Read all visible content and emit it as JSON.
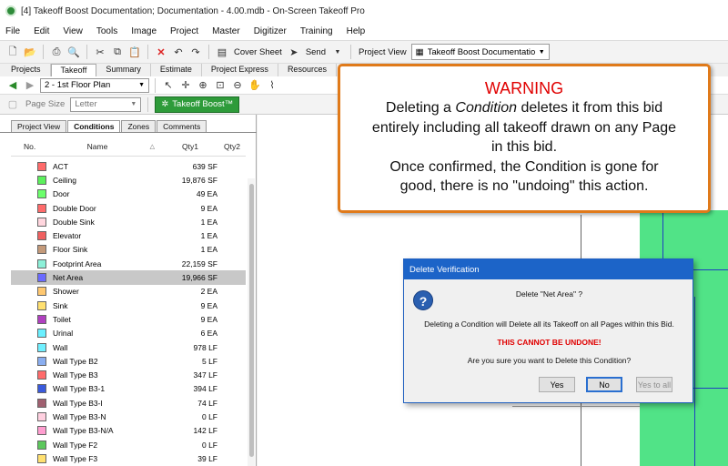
{
  "window": {
    "title": "[4] Takeoff Boost Documentation; Documentation - 4.00.mdb - On-Screen Takeoff Pro"
  },
  "menu": [
    "File",
    "Edit",
    "View",
    "Tools",
    "Image",
    "Project",
    "Master",
    "Digitizer",
    "Training",
    "Help"
  ],
  "toolbar": {
    "cover_sheet": "Cover Sheet",
    "send": "Send",
    "project_view_label": "Project View",
    "project_combo": "Takeoff Boost Documentatio"
  },
  "main_tabs": [
    "Projects",
    "Takeoff",
    "Summary",
    "Estimate",
    "Project Express",
    "Resources"
  ],
  "active_main_tab": "Takeoff",
  "page_combo": "2 - 1st Floor Plan",
  "page_size_label": "Page Size",
  "page_size_value": "Letter",
  "boost_button": "Takeoff Boost™",
  "panel_tabs": [
    "Project View",
    "Conditions",
    "Zones",
    "Comments"
  ],
  "active_panel_tab": "Conditions",
  "grid_headers": {
    "no": "No.",
    "name": "Name",
    "qty1": "Qty1",
    "qty2": "Qty2"
  },
  "conditions": [
    {
      "name": "ACT",
      "qty1": "639 SF",
      "color": "#ff6b6b"
    },
    {
      "name": "Ceiling",
      "qty1": "19,876 SF",
      "color": "#5cf05c"
    },
    {
      "name": "Door",
      "qty1": "49 EA",
      "color": "#6cff6c"
    },
    {
      "name": "Double Door",
      "qty1": "9 EA",
      "color": "#ff6b6b"
    },
    {
      "name": "Double Sink",
      "qty1": "1 EA",
      "color": "#ffd6de"
    },
    {
      "name": "Elevator",
      "qty1": "1 EA",
      "color": "#f06060"
    },
    {
      "name": "Floor Sink",
      "qty1": "1 EA",
      "color": "#c49a7a"
    },
    {
      "name": "Footprint Area",
      "qty1": "22,159 SF",
      "color": "#8cf0d8"
    },
    {
      "name": "Net Area",
      "qty1": "19,966 SF",
      "color": "#6a6aff"
    },
    {
      "name": "Shower",
      "qty1": "2 EA",
      "color": "#ffc870"
    },
    {
      "name": "Sink",
      "qty1": "9 EA",
      "color": "#ffe070"
    },
    {
      "name": "Toilet",
      "qty1": "9 EA",
      "color": "#b040c0"
    },
    {
      "name": "Urinal",
      "qty1": "6 EA",
      "color": "#6af0ff"
    },
    {
      "name": "Wall",
      "qty1": "978 LF",
      "color": "#70f0ff"
    },
    {
      "name": "Wall Type B2",
      "qty1": "5 LF",
      "color": "#8aaef0"
    },
    {
      "name": "Wall Type B3",
      "qty1": "347 LF",
      "color": "#ff6b6b"
    },
    {
      "name": "Wall Type B3-1",
      "qty1": "394 LF",
      "color": "#3a5adc"
    },
    {
      "name": "Wall Type B3-I",
      "qty1": "74 LF",
      "color": "#a06070"
    },
    {
      "name": "Wall Type B3-N",
      "qty1": "0 LF",
      "color": "#ffd0e0"
    },
    {
      "name": "Wall Type B3-N/A",
      "qty1": "142 LF",
      "color": "#ff9ed0"
    },
    {
      "name": "Wall Type F2",
      "qty1": "0 LF",
      "color": "#5cc85c"
    },
    {
      "name": "Wall Type F3",
      "qty1": "39 LF",
      "color": "#ffe070"
    }
  ],
  "selected_condition": "Net Area",
  "warning": {
    "title": "WARNING",
    "line1_pre": "Deleting a ",
    "line1_em": "Condition",
    "line1_post": " deletes it from this bid",
    "line2": "entirely including all takeoff drawn on any Page",
    "line3": "in this bid.",
    "line4": "Once confirmed, the Condition is gone for",
    "line5": "good, there is no \"undoing\" this action."
  },
  "dialog": {
    "title": "Delete Verification",
    "question": "Delete \"Net Area\" ?",
    "info": "Deleting a Condition will Delete all its Takeoff on all Pages within this Bid.",
    "danger": "THIS CANNOT BE UNDONE!",
    "confirm": "Are you sure you want to Delete this Condition?",
    "yes": "Yes",
    "no": "No",
    "yes_to_all": "Yes to all"
  }
}
